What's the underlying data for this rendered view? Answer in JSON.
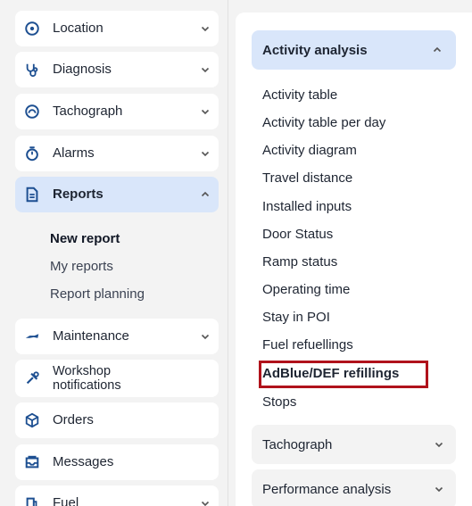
{
  "sidebar": {
    "items": [
      {
        "label": "Location",
        "icon": "location-pin-icon"
      },
      {
        "label": "Diagnosis",
        "icon": "stethoscope-icon"
      },
      {
        "label": "Tachograph",
        "icon": "tachograph-icon"
      },
      {
        "label": "Alarms",
        "icon": "stopwatch-icon"
      },
      {
        "label": "Reports",
        "icon": "document-icon"
      },
      {
        "label": "Maintenance",
        "icon": "wrench-icon"
      },
      {
        "label": "Workshop notifications",
        "icon": "tools-icon"
      },
      {
        "label": "Orders",
        "icon": "box-icon"
      },
      {
        "label": "Messages",
        "icon": "inbox-icon"
      },
      {
        "label": "Fuel",
        "icon": "fuel-icon"
      }
    ],
    "reports_sub": [
      "New report",
      "My reports",
      "Report planning"
    ]
  },
  "panel": {
    "header": "Activity analysis",
    "items": [
      "Activity table",
      "Activity table per day",
      "Activity diagram",
      "Travel distance",
      "Installed inputs",
      "Door Status",
      "Ramp status",
      "Operating time",
      "Stay in POI",
      "Fuel refuellings",
      "AdBlue/DEF refillings",
      "Stops"
    ],
    "groups": [
      "Tachograph",
      "Performance analysis"
    ]
  },
  "colors": {
    "accent_bg": "#d9e6fa",
    "icon_blue": "#1d4f91",
    "highlight_border": "#b0121b"
  }
}
